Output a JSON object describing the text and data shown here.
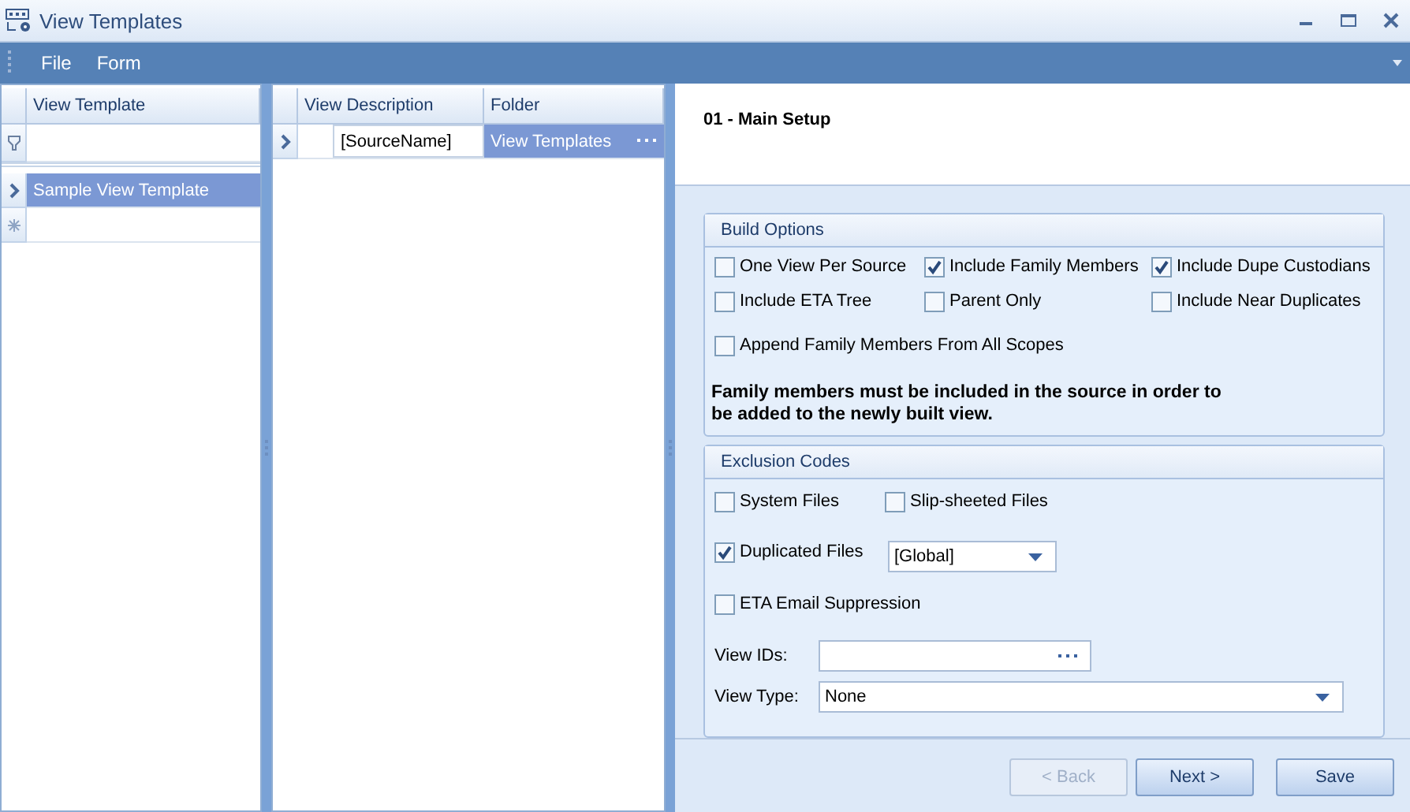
{
  "window": {
    "title": "View Templates"
  },
  "menu": [
    {
      "label": "File"
    },
    {
      "label": "Form"
    }
  ],
  "templates_grid": {
    "columns": [
      "View Template"
    ],
    "rows": [
      {
        "cells": [
          "Sample View Template"
        ],
        "selected": true
      }
    ]
  },
  "detail_grid": {
    "columns": [
      "View Description",
      "Folder"
    ],
    "rows": [
      {
        "cells": [
          "[SourceName]",
          "View Templates"
        ],
        "selected": true
      }
    ]
  },
  "page_title": "01 - Main Setup",
  "build_options": {
    "title": "Build Options",
    "options": [
      {
        "label": "One View Per Source",
        "checked": false
      },
      {
        "label": "Include Family Members",
        "checked": true
      },
      {
        "label": "Include Dupe Custodians",
        "checked": true
      },
      {
        "label": "Include ETA Tree",
        "checked": false
      },
      {
        "label": "Parent Only",
        "checked": false
      },
      {
        "label": "Include Near Duplicates",
        "checked": false
      },
      {
        "label": "Append Family Members From All Scopes",
        "checked": false
      }
    ],
    "note": "Family members must be included in the source in order to be added to the newly built view."
  },
  "exclusion_codes": {
    "title": "Exclusion Codes",
    "rows": [
      {
        "kind": "pair",
        "items": [
          {
            "label": "System Files",
            "checked": false
          },
          {
            "label": "Slip-sheeted Files",
            "checked": false
          }
        ]
      },
      {
        "kind": "dropdown",
        "items": [
          {
            "label": "Duplicated Files",
            "checked": true
          }
        ],
        "value": "[Global]"
      },
      {
        "kind": "single",
        "items": [
          {
            "label": "ETA Email Suppression",
            "checked": false
          }
        ]
      }
    ],
    "fields": [
      {
        "label": "View IDs:",
        "kind": "browse"
      },
      {
        "label": "View Type:",
        "kind": "dropdown",
        "value": "None"
      }
    ]
  },
  "buttons": [
    {
      "label": "< Back",
      "disabled": true
    },
    {
      "label": "Next >",
      "disabled": false
    },
    {
      "label": "Save",
      "disabled": false
    }
  ]
}
